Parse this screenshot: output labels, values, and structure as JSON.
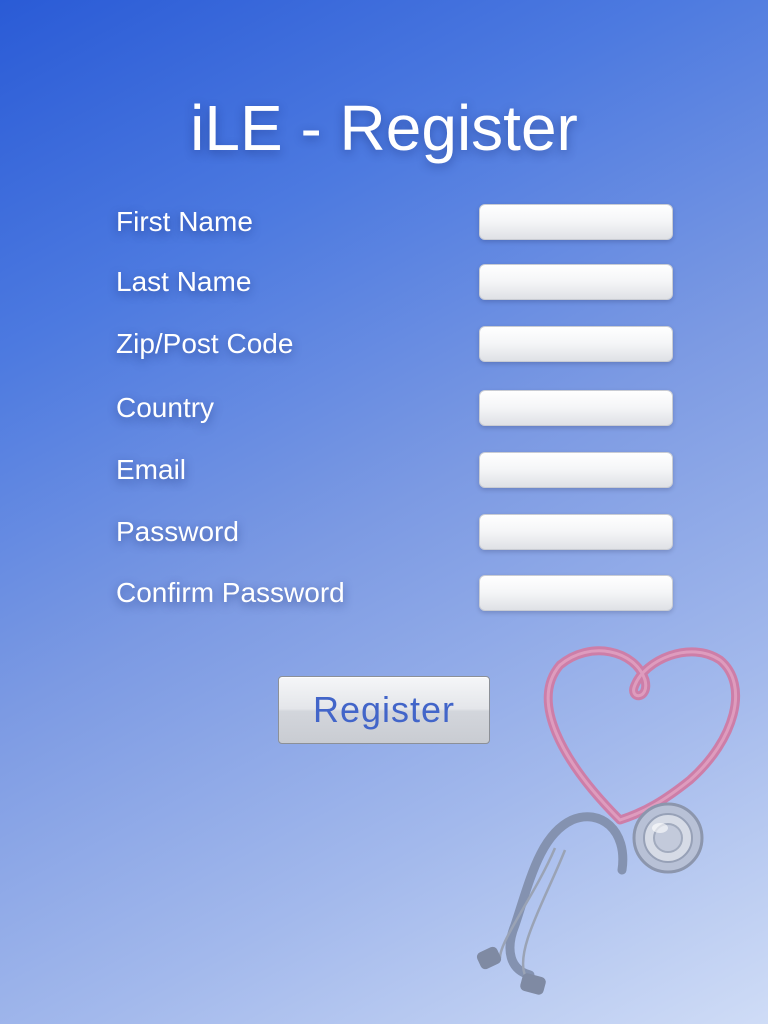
{
  "header": {
    "title": "iLE - Register"
  },
  "form": {
    "fields": [
      {
        "label": "First Name",
        "value": "",
        "placeholder": ""
      },
      {
        "label": "Last Name",
        "value": "",
        "placeholder": ""
      },
      {
        "label": "Zip/Post Code",
        "value": "",
        "placeholder": ""
      },
      {
        "label": "Country",
        "value": "",
        "placeholder": ""
      },
      {
        "label": "Email",
        "value": "",
        "placeholder": ""
      },
      {
        "label": "Password",
        "value": "",
        "placeholder": ""
      },
      {
        "label": "Confirm Password",
        "value": "",
        "placeholder": ""
      }
    ],
    "submit_label": "Register"
  },
  "decoration": {
    "icon": "heart-stethoscope-icon"
  },
  "colors": {
    "background_start": "#2a5bd6",
    "background_end": "#cfdcf6",
    "button_text": "#4265c9",
    "heart_tube": "#cd7ea8",
    "stethoscope_tube": "#8492b0"
  }
}
